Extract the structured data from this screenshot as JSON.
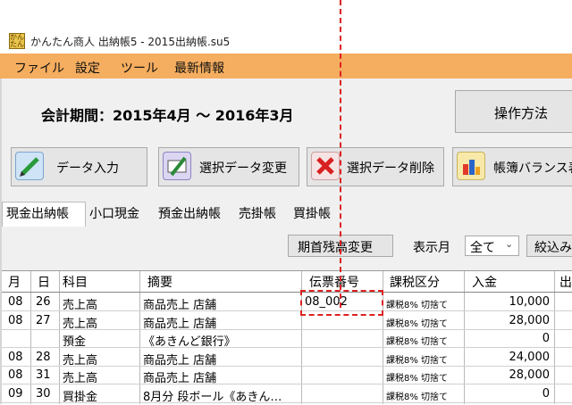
{
  "window": {
    "title": "かんたん商人 出納帳5 - 2015出納帳.su5",
    "icon_text": "かんたん"
  },
  "menu": [
    "ファイル",
    "設定",
    "ツール",
    "最新情報"
  ],
  "period": "会計期間：2015年4月 〜 2016年3月",
  "operation_button": "操作方法",
  "toolbar": [
    {
      "label": "データ入力",
      "icon": "pencil-icon"
    },
    {
      "label": "選択データ変更",
      "icon": "edit-card-icon"
    },
    {
      "label": "選択データ削除",
      "icon": "delete-x-icon"
    },
    {
      "label": "帳簿バランス表",
      "icon": "bar-chart-icon"
    }
  ],
  "tabs": [
    "現金出納帳",
    "小口現金",
    "預金出納帳",
    "売掛帳",
    "買掛帳"
  ],
  "filters": {
    "opening_button": "期首残高変更",
    "view_label": "表示月",
    "view_value": "全て",
    "narrow_button": "絞込み"
  },
  "table": {
    "headers": [
      "月",
      "日",
      "科目",
      "摘要",
      "伝票番号",
      "課税区分",
      "入金",
      "出"
    ],
    "rows": [
      [
        "08",
        "26",
        "売上高",
        "商品売上 店舗",
        "08_002",
        "課税8% 切捨て",
        "10,000"
      ],
      [
        "08",
        "27",
        "売上高",
        "商品売上 店舗",
        "",
        "課税8% 切捨て",
        "28,000"
      ],
      [
        "",
        "",
        "預金",
        "《あきんど銀行》",
        "",
        "課税8% 切捨て",
        "0"
      ],
      [
        "08",
        "28",
        "売上高",
        "商品売上 店舗",
        "",
        "課税8% 切捨て",
        "24,000"
      ],
      [
        "08",
        "31",
        "売上高",
        "商品売上 店舗",
        "",
        "課税8% 切捨て",
        "28,000"
      ],
      [
        "09",
        "30",
        "買掛金",
        "8月分 段ボール《あきん…",
        "",
        "課税8% 切捨て",
        "0"
      ]
    ]
  },
  "colors": {
    "menu_bg": "#f5ad5f",
    "highlight": "#dd2222"
  }
}
